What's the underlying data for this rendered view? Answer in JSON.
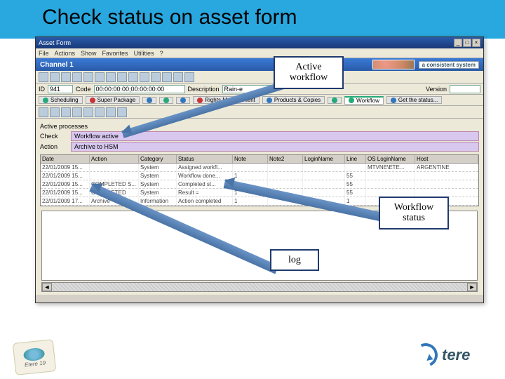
{
  "slide": {
    "title": "Check status on asset form"
  },
  "callouts": {
    "active": "Active\nworkflow",
    "status": "Workflow\nstatus",
    "log": "log"
  },
  "window": {
    "title": "Asset Form",
    "menus": [
      "File",
      "Actions",
      "Show",
      "Favorites",
      "Utilities",
      "?"
    ],
    "channel": "Channel 1",
    "system_tag": "a consistent system",
    "id_label": "ID",
    "id_value": "941",
    "code_label": "Code",
    "code_value": "00:00:00:00;00:00:00:00",
    "desc_label": "Description",
    "desc_value": "Rain-e",
    "version_label": "Version"
  },
  "tabs": {
    "items": [
      "Scheduling",
      "Super Package",
      "",
      "",
      "",
      "Rights Management",
      "Products & Copies",
      "",
      "Workflow",
      "Get the status..."
    ]
  },
  "section": {
    "heading": "Active processes",
    "check_label": "Check",
    "check_value": "Workflow active",
    "action_label": "Action",
    "action_value": "Archive to HSM"
  },
  "grid": {
    "cols": [
      "Date",
      "Action",
      "Category",
      "Status",
      "Note",
      "Note2",
      "LoginName",
      "Line",
      "OS LoginName",
      "Host"
    ],
    "rows": [
      [
        "22/01/2009 15...",
        "",
        "System",
        "Assigned workfl...",
        "",
        "",
        "",
        "",
        "MTVNE\\ETE...",
        "ARGENTINE"
      ],
      [
        "22/01/2009 15...",
        "",
        "System",
        "Workflow done...",
        "1",
        "",
        "",
        "55",
        "",
        ""
      ],
      [
        "22/01/2009 15...",
        "COMPLETED S...",
        "System",
        "Completed st...",
        "1",
        "",
        "",
        "55",
        "",
        ""
      ],
      [
        "22/01/2009 15...",
        "COMPLETED",
        "System",
        "Result =",
        "1",
        "",
        "",
        "55",
        "",
        ""
      ],
      [
        "22/01/2009 17...",
        "Archive - HSM",
        "Information",
        "Action completed",
        "1",
        "",
        "",
        "1",
        "",
        ""
      ]
    ]
  },
  "logos": {
    "left": "Etere 19",
    "right": "tere"
  }
}
